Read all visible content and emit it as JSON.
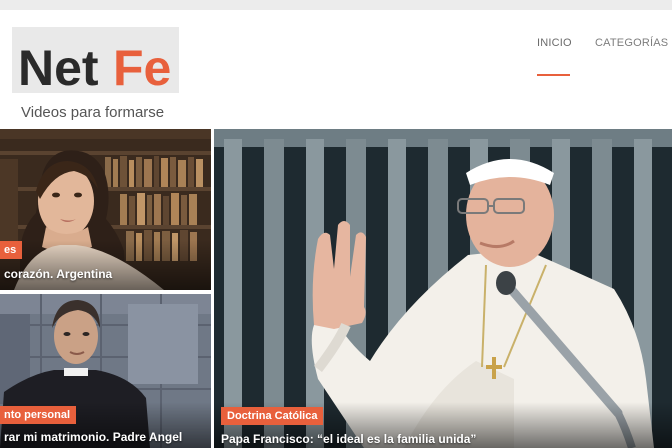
{
  "site": {
    "logo_word_dark": "Net",
    "logo_word_accent": "Fe",
    "tagline": "Videos para formarse",
    "accent_color": "#e8603c"
  },
  "nav": {
    "items": [
      {
        "label": "INICIO",
        "active": true
      },
      {
        "label": "CATEGORÍAS DE"
      }
    ]
  },
  "cards": [
    {
      "category": "es",
      "title": "corazón. Argentina"
    },
    {
      "category": "nto personal",
      "title": "rar mi matrimonio. Padre Angel"
    },
    {
      "category": "Doctrina Católica",
      "title": "Papa Francisco: “el ideal es la familia unida”"
    }
  ]
}
